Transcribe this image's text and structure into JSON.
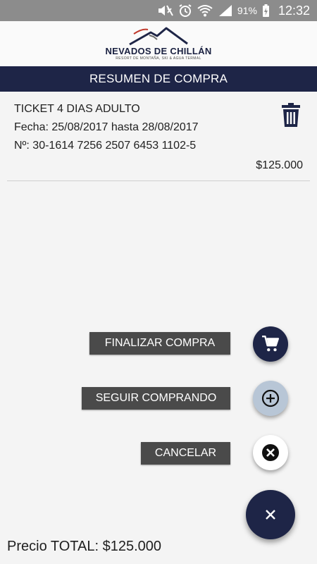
{
  "status_bar": {
    "battery": "91%",
    "time": "12:32",
    "icons": [
      "mute-icon",
      "alarm-icon",
      "wifi-icon",
      "signal-icon",
      "battery-charging-icon"
    ]
  },
  "header": {
    "logo_title": "NEVADOS DE CHILLÁN",
    "logo_subtitle": "RESORT DE MONTAÑA, SKI & AGUA TERMAL",
    "screen_title": "RESUMEN DE COMPRA"
  },
  "ticket": {
    "name": "TICKET 4 DIAS ADULTO",
    "date_line": "Fecha:  25/08/2017 hasta 28/08/2017",
    "number_line": "Nº:  30-1614 7256 2507 6453 1102-5",
    "price": "$125.000"
  },
  "actions": {
    "finalize": "FINALIZAR COMPRA",
    "continue": "SEGUIR COMPRANDO",
    "cancel": "CANCELAR"
  },
  "total": {
    "label": "Precio TOTAL:  $125.000"
  },
  "colors": {
    "navy": "#1e2547",
    "label_bg": "#4a4a4a",
    "plus_fab_bg": "#b8c6d6",
    "white_fab_bg": "#ffffff"
  }
}
